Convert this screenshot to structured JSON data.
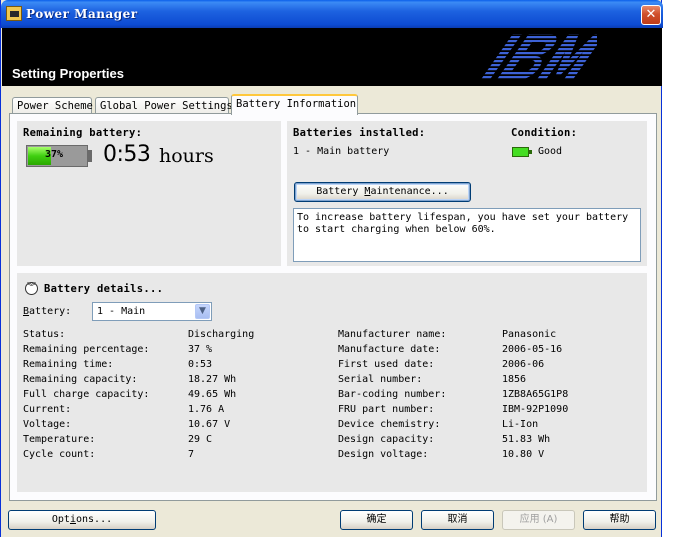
{
  "window": {
    "title": "Power Manager"
  },
  "banner": {
    "title": "Setting Properties",
    "logo": "IBM"
  },
  "tabs": [
    {
      "label": "Power Scheme"
    },
    {
      "label": "Global Power Settings"
    },
    {
      "label": "Battery Information"
    }
  ],
  "remaining": {
    "label": "Remaining battery:",
    "percent_text": "37%",
    "percent_value": 37,
    "time": "0:53",
    "unit": "hours"
  },
  "installed": {
    "label": "Batteries installed:",
    "value": "1 - Main battery",
    "condition_label": "Condition:",
    "condition_value": "Good"
  },
  "maintenance_button": {
    "prefix": "Battery ",
    "accel": "M",
    "suffix": "aintenance..."
  },
  "info_text": "To increase battery lifespan, you have set your battery\nto start charging when below 60%.",
  "details": {
    "title": "Battery details...",
    "battery_label_accel": "B",
    "battery_label_rest": "attery:",
    "battery_selected": "1 - Main",
    "left": [
      {
        "label": "Status:",
        "value": "Discharging"
      },
      {
        "label": "Remaining percentage:",
        "value": "37 %"
      },
      {
        "label": "Remaining time:",
        "value": "0:53"
      },
      {
        "label": "Remaining capacity:",
        "value": "18.27 Wh"
      },
      {
        "label": "Full charge capacity:",
        "value": "49.65 Wh"
      },
      {
        "label": "Current:",
        "value": "1.76 A"
      },
      {
        "label": "Voltage:",
        "value": "10.67 V"
      },
      {
        "label": "Temperature:",
        "value": "29 C"
      },
      {
        "label": "Cycle count:",
        "value": "7"
      }
    ],
    "right": [
      {
        "label": "Manufacturer name:",
        "value": "Panasonic"
      },
      {
        "label": "Manufacture date:",
        "value": "2006-05-16"
      },
      {
        "label": "First used date:",
        "value": "2006-06"
      },
      {
        "label": "Serial number:",
        "value": "1856"
      },
      {
        "label": "Bar-coding number:",
        "value": "1ZB8A65G1P8"
      },
      {
        "label": "FRU part number:",
        "value": "IBM-92P1090"
      },
      {
        "label": "Device chemistry:",
        "value": "Li-Ion"
      },
      {
        "label": "Design capacity:",
        "value": "51.83 Wh"
      },
      {
        "label": "Design voltage:",
        "value": "10.80 V"
      }
    ]
  },
  "footer": {
    "options_prefix": "Opt",
    "options_accel": "i",
    "options_suffix": "ons...",
    "ok": "确定",
    "cancel": "取消",
    "apply": "应用 (A)",
    "help": "帮助"
  },
  "colors": {
    "titlebar": "#0d4bd2",
    "banner": "#000000",
    "battery_fill": "#3fcf10",
    "tab_highlight": "#ffc83c"
  }
}
